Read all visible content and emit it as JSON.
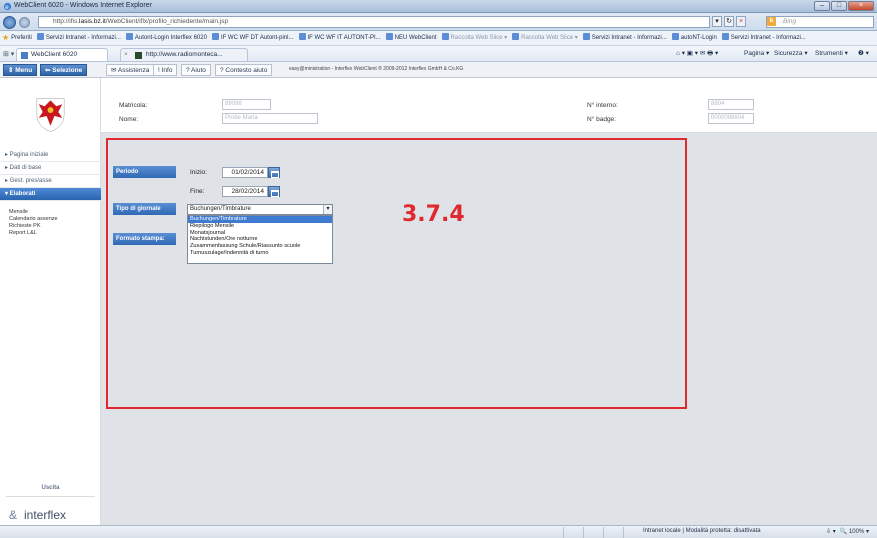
{
  "window": {
    "title": "WebClient 6020 - Windows Internet Explorer",
    "buttons": [
      "–",
      "□",
      "×"
    ]
  },
  "address": {
    "url_prefix": "http://ifis.",
    "url_host": "lasis.bz.it",
    "url_rest": "/WebClient/iflx/profilo_richiedente/main.jsp",
    "search_placeholder": "Bing",
    "search_badge": "b"
  },
  "favorites": [
    {
      "label": "Preferiti",
      "dim": false
    },
    {
      "label": "Servizi Intranet - Informazi...",
      "dim": false
    },
    {
      "label": "Autont-Login Interflex 6020",
      "dim": false
    },
    {
      "label": "IF WC WF DT Autont-pinl...",
      "dim": false
    },
    {
      "label": "IF WC WF IT AUTONT-PI...",
      "dim": false
    },
    {
      "label": "NEU WebClient",
      "dim": false
    },
    {
      "label": "Raccolta Web Slice ▾",
      "dim": true
    },
    {
      "label": "Raccolta Web Slice ▾",
      "dim": true
    },
    {
      "label": "Servizi Intranet - Informazi...",
      "dim": false
    },
    {
      "label": "autoNT-Login",
      "dim": false
    },
    {
      "label": "Servizi Intranet - Informazi...",
      "dim": false
    }
  ],
  "tabs": {
    "tab1": "WebClient 6020",
    "tab2": "http://www.radiomonteca...",
    "tab_grid": "⊞ ▾",
    "tab_close": "×"
  },
  "commands": {
    "pagina": "Pagina ▾",
    "sicurezza": "Sicurezza ▾",
    "strumenti": "Strumenti ▾",
    "help": "❷ ▾",
    "icons": "⌂ ▾  ▣ ▾  ✉  🖶 ▾"
  },
  "apptoolbar": {
    "menu": "⇕ Menu",
    "selezione": "⇐ Selezione",
    "assistenza": "✉ Assistenza",
    "info": "! Info",
    "aiuto": "? Aiuto",
    "contesto": "? Contesto aiuto",
    "copyright": "easy@ministration - Interflex WebClient ® 2009-2012 Interflex GmbH & Co.KG"
  },
  "header": {
    "matricola_label": "Matricola:",
    "matricola_value": "89098",
    "nome_label": "Nome:",
    "nome_value": "Probe Maria",
    "interno_label": "N° interno:",
    "interno_value": "8804",
    "badge_label": "N° badge:",
    "badge_value": "0000098804"
  },
  "sidebar": {
    "items": [
      {
        "label": "▸ Pagina iniziale",
        "active": false
      },
      {
        "label": "▸ Dati di base",
        "active": false
      },
      {
        "label": "▸ Gest. pres/asse",
        "active": false
      },
      {
        "label": "▾ Elaborati",
        "active": true
      }
    ],
    "subitems": [
      "Mensile",
      "Calendario assenze",
      "Richieste PK",
      "Report L&L"
    ],
    "logout": "Uscita",
    "logo": "interflex",
    "logo_mark": "&"
  },
  "form": {
    "periodo": "Periodo",
    "inizio_label": "Inizio:",
    "inizio_value": "01/02/2014",
    "fine_label": "Fine:",
    "fine_value": "28/02/2014",
    "tipo_giornale": "Tipo di giornale",
    "formato_stampa": "Formato stampa:",
    "selected": "Buchungen/Timbrature",
    "arrow": "▾",
    "options": [
      "Buchungen/Timbrature",
      "Riepilogo Mensile",
      "Monatsjournal",
      "Nachtstunden/Ore notturne",
      "Zusammenfassung Schule/Riassunto scuole",
      "Turnuszulage/Indennità di turno"
    ]
  },
  "annotation": "3.7.4",
  "status": {
    "zone": "Intranet locale | Modalità protetta: disattivata",
    "zoom": "🔍 100%  ▾",
    "zone_ctrl": "⇩ ▾"
  },
  "colors": {
    "accent": "#2f68b4",
    "annotation": "#e0292d",
    "content_bg": "#dfe3e8"
  }
}
